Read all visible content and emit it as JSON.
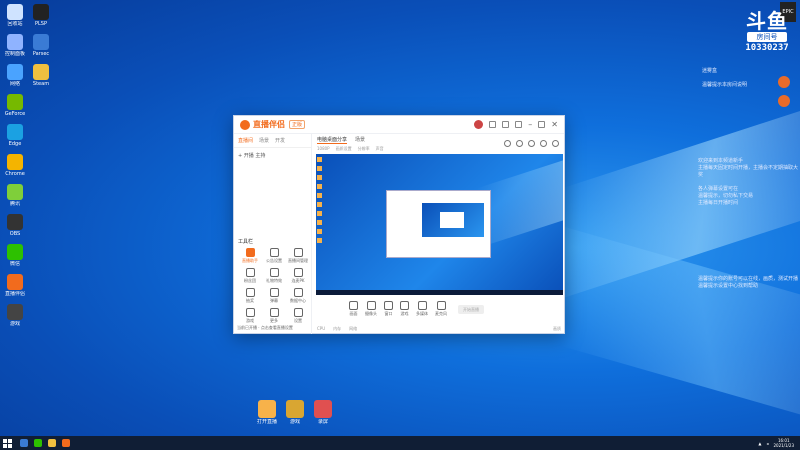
{
  "desktop": {
    "icons": [
      {
        "label": "回收站",
        "color": "#cfe3ff"
      },
      {
        "label": "PLSP",
        "color": "#222222"
      },
      {
        "label": "控制面板",
        "color": "#8fb3ff"
      },
      {
        "label": "Parsec",
        "color": "#3a7bd5"
      },
      {
        "label": "网络",
        "color": "#4aa3ff"
      },
      {
        "label": "Steam",
        "color": "#f0c040"
      },
      {
        "label": "GeForce",
        "color": "#76b900"
      },
      {
        "label": "",
        "color": "#00000000"
      },
      {
        "label": "Edge",
        "color": "#1ba1e2"
      },
      {
        "label": "",
        "color": "#00000000"
      },
      {
        "label": "Chrome",
        "color": "#f4b400"
      },
      {
        "label": "",
        "color": "#00000000"
      },
      {
        "label": "腾讯",
        "color": "#7fcf3a"
      },
      {
        "label": "",
        "color": "#00000000"
      },
      {
        "label": "OBS",
        "color": "#333333"
      },
      {
        "label": "",
        "color": "#00000000"
      },
      {
        "label": "微信",
        "color": "#2dc100"
      },
      {
        "label": "",
        "color": "#00000000"
      },
      {
        "label": "直播伴侣",
        "color": "#f26b1d"
      },
      {
        "label": "",
        "color": "#00000000"
      },
      {
        "label": "游戏",
        "color": "#444444"
      },
      {
        "label": "",
        "color": "#00000000"
      }
    ],
    "bottom_icons": [
      {
        "label": "打开直播",
        "color": "#f7b24a"
      },
      {
        "label": "游戏",
        "color": "#d9a632"
      },
      {
        "label": "录屏",
        "color": "#e05050"
      }
    ]
  },
  "overlay": {
    "logo": "斗鱼",
    "room_tag": "房间号",
    "room_number": "10330237",
    "epic": "EPIC",
    "notes1": "迷雾盒\n\n温馨提示本房间说明",
    "notes2": "欢迎来到本频道新手\n主播每天固定时间开播，主播会不定期抽取大奖\n\n各人弹幕设置可在\n温馨提示，切勿私下交易\n主播每日开播时间",
    "notes3": "温馨提示你的账号可以在线，画质，测试开播\n温馨提示设置中心找到帮助"
  },
  "window": {
    "app_name": "直播伴侣",
    "version": "正版",
    "left_tabs": [
      "直播间",
      "场景",
      "开发"
    ],
    "group_row": "+  开播  主持",
    "tools_title": "工具栏",
    "tools": [
      {
        "label": "直播助手",
        "hl": true
      },
      {
        "label": "公告设置",
        "hl": false
      },
      {
        "label": "直播间管理",
        "hl": false
      },
      {
        "label": "粉丝团",
        "hl": false
      },
      {
        "label": "礼物特效",
        "hl": false
      },
      {
        "label": "连麦PK",
        "hl": false
      },
      {
        "label": "抽奖",
        "hl": false
      },
      {
        "label": "弹幕",
        "hl": false
      },
      {
        "label": "数据中心",
        "hl": false
      },
      {
        "label": "游戏",
        "hl": false
      },
      {
        "label": "更多",
        "hl": false
      },
      {
        "label": "设置",
        "hl": false
      }
    ],
    "left_status": "当前已开播 · 点击查看直播设置",
    "right_tabs": [
      "电脑桌面分享",
      "场景"
    ],
    "right_info": [
      "1080P",
      "画质设置",
      "分辨率",
      "声音"
    ],
    "controls": [
      {
        "label": "画面",
        "name": "screen"
      },
      {
        "label": "摄像头",
        "name": "camera"
      },
      {
        "label": "窗口",
        "name": "window"
      },
      {
        "label": "游戏",
        "name": "game"
      },
      {
        "label": "多媒体",
        "name": "media"
      },
      {
        "label": "麦克风",
        "name": "mic"
      }
    ],
    "start_label": "开始直播",
    "footer": [
      "CPU",
      "内存",
      "网络"
    ],
    "footer_right": "画质"
  },
  "taskbar": {
    "time": "16:01",
    "date": "2021/1/23"
  }
}
